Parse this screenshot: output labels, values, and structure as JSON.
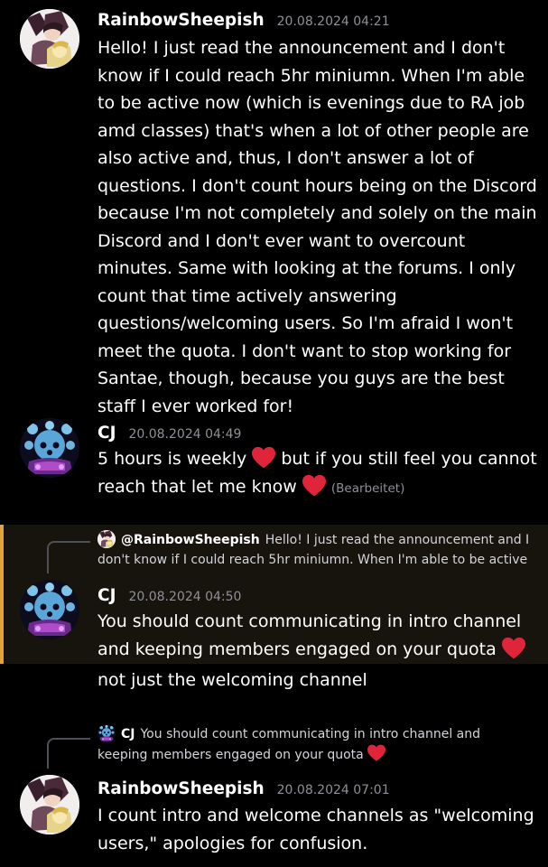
{
  "messages": [
    {
      "author": "RainbowSheepish",
      "timestamp": "20.08.2024 04:21",
      "text": "Hello! I just read the announcement and I don't know if I could reach 5hr miniumn. When I'm able to be active now (which is evenings due to RA job amd classes) that's when a lot of other people are also active and, thus, I don't answer a lot of questions. I don't count hours being on the Discord because I'm not completely and solely on the main Discord and I don't ever want to overcount minutes. Same with looking at the forums. I only count that time actively answering questions/welcoming users. So I'm afraid I won't meet the quota. I don't want to stop working for Santae, though, because you guys are the best staff I ever worked for!"
    },
    {
      "author": "CJ",
      "timestamp": "20.08.2024 04:49",
      "text_part1": "5 hours is weekly",
      "text_part2": "but if you still feel you cannot reach that let me know",
      "edited": "(Bearbeitet)"
    },
    {
      "reply_to_mention": "@RainbowSheepish",
      "reply_preview": "Hello! I just read the announcement and I don't know if I could reach 5hr miniumn. When I'm able to be active",
      "author": "CJ",
      "timestamp": "20.08.2024 04:50",
      "text": "You should count communicating in intro channel and keeping members engaged on your quota",
      "followup": "not just the welcoming channel"
    },
    {
      "reply_to_name": "CJ",
      "reply_preview": "You should count communicating in intro channel and keeping members engaged on your quota",
      "author": "RainbowSheepish",
      "timestamp": "20.08.2024 07:01",
      "text": "I count intro and welcome channels as \"welcoming users,\" apologies for confusion."
    }
  ],
  "colors": {
    "background": "#000000",
    "timestamp": "#8f9098",
    "highlight_bar": "#e2a33a",
    "heart": "#e0243a"
  }
}
